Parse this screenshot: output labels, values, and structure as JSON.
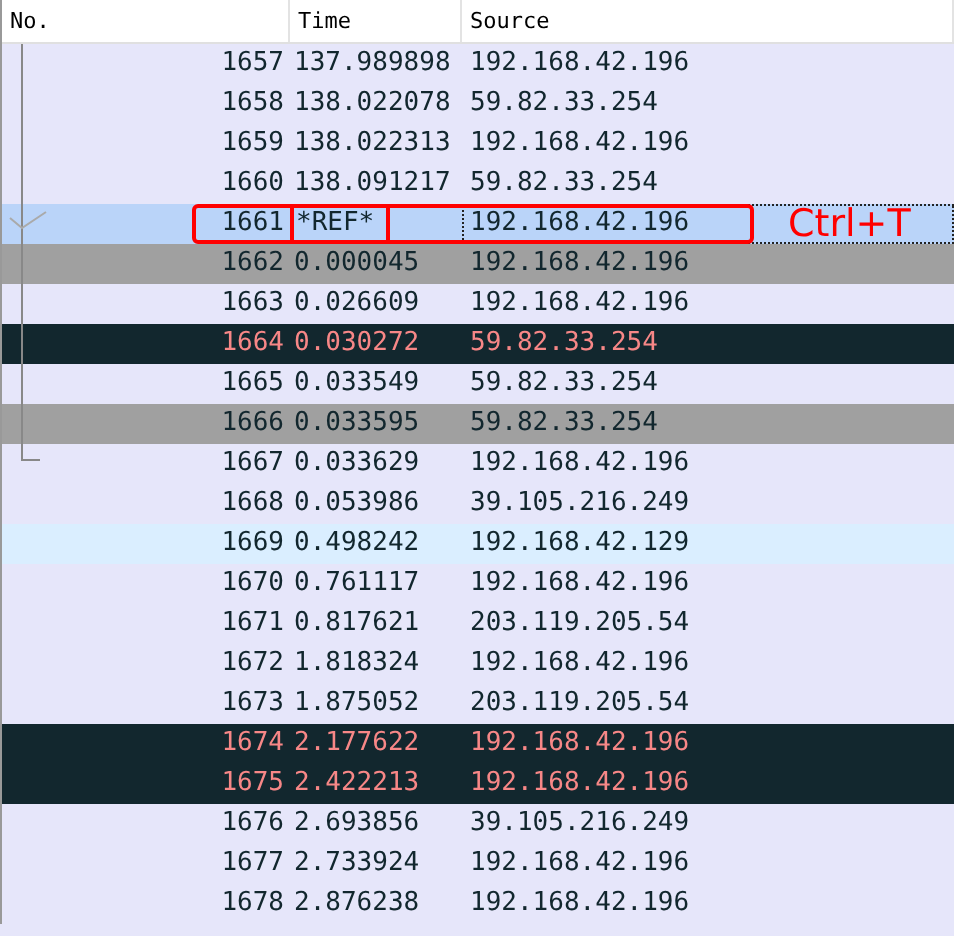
{
  "table": {
    "columns": [
      "No.",
      "Time",
      "Source"
    ],
    "rows": [
      {
        "no": "1657",
        "time": "137.989898",
        "source": "192.168.42.196",
        "kind": "normal",
        "selected": false
      },
      {
        "no": "1658",
        "time": "138.022078",
        "source": "59.82.33.254",
        "kind": "normal",
        "selected": false
      },
      {
        "no": "1659",
        "time": "138.022313",
        "source": "192.168.42.196",
        "kind": "normal",
        "selected": false
      },
      {
        "no": "1660",
        "time": "138.091217",
        "source": "59.82.33.254",
        "kind": "normal",
        "selected": false
      },
      {
        "no": "1661",
        "time": "*REF*",
        "source": "192.168.42.196",
        "kind": "normal",
        "selected": true,
        "outlined": true,
        "note": "Ctrl+T"
      },
      {
        "no": "1662",
        "time": "0.000045",
        "source": "192.168.42.196",
        "kind": "gray",
        "selected": false
      },
      {
        "no": "1663",
        "time": "0.026609",
        "source": "192.168.42.196",
        "kind": "normal",
        "selected": false
      },
      {
        "no": "1664",
        "time": "0.030272",
        "source": "59.82.33.254",
        "kind": "dark",
        "selected": false
      },
      {
        "no": "1665",
        "time": "0.033549",
        "source": "59.82.33.254",
        "kind": "normal",
        "selected": false
      },
      {
        "no": "1666",
        "time": "0.033595",
        "source": "59.82.33.254",
        "kind": "gray",
        "selected": false
      },
      {
        "no": "1667",
        "time": "0.033629",
        "source": "192.168.42.196",
        "kind": "normal",
        "selected": false
      },
      {
        "no": "1668",
        "time": "0.053986",
        "source": "39.105.216.249",
        "kind": "normal",
        "selected": false
      },
      {
        "no": "1669",
        "time": "0.498242",
        "source": "192.168.42.129",
        "kind": "light",
        "selected": false
      },
      {
        "no": "1670",
        "time": "0.761117",
        "source": "192.168.42.196",
        "kind": "normal",
        "selected": false
      },
      {
        "no": "1671",
        "time": "0.817621",
        "source": "203.119.205.54",
        "kind": "normal",
        "selected": false
      },
      {
        "no": "1672",
        "time": "1.818324",
        "source": "192.168.42.196",
        "kind": "normal",
        "selected": false
      },
      {
        "no": "1673",
        "time": "1.875052",
        "source": "203.119.205.54",
        "kind": "normal",
        "selected": false
      },
      {
        "no": "1674",
        "time": "2.177622",
        "source": "192.168.42.196",
        "kind": "dark",
        "selected": false
      },
      {
        "no": "1675",
        "time": "2.422213",
        "source": "192.168.42.196",
        "kind": "dark",
        "selected": false
      },
      {
        "no": "1676",
        "time": "2.693856",
        "source": "39.105.216.249",
        "kind": "normal",
        "selected": false
      },
      {
        "no": "1677",
        "time": "2.733924",
        "source": "192.168.42.196",
        "kind": "normal",
        "selected": false
      },
      {
        "no": "1678",
        "time": "2.876238",
        "source": "192.168.42.196",
        "kind": "normal",
        "selected": false
      }
    ]
  }
}
